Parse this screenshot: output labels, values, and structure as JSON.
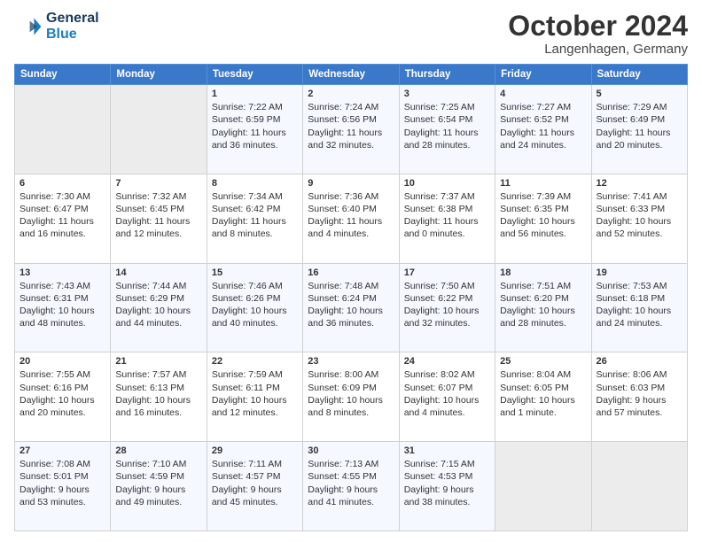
{
  "header": {
    "logo_line1": "General",
    "logo_line2": "Blue",
    "month": "October 2024",
    "location": "Langenhagen, Germany"
  },
  "weekdays": [
    "Sunday",
    "Monday",
    "Tuesday",
    "Wednesday",
    "Thursday",
    "Friday",
    "Saturday"
  ],
  "weeks": [
    [
      {
        "day": "",
        "lines": [],
        "empty": true
      },
      {
        "day": "",
        "lines": [],
        "empty": true
      },
      {
        "day": "1",
        "lines": [
          "Sunrise: 7:22 AM",
          "Sunset: 6:59 PM",
          "Daylight: 11 hours",
          "and 36 minutes."
        ]
      },
      {
        "day": "2",
        "lines": [
          "Sunrise: 7:24 AM",
          "Sunset: 6:56 PM",
          "Daylight: 11 hours",
          "and 32 minutes."
        ]
      },
      {
        "day": "3",
        "lines": [
          "Sunrise: 7:25 AM",
          "Sunset: 6:54 PM",
          "Daylight: 11 hours",
          "and 28 minutes."
        ]
      },
      {
        "day": "4",
        "lines": [
          "Sunrise: 7:27 AM",
          "Sunset: 6:52 PM",
          "Daylight: 11 hours",
          "and 24 minutes."
        ]
      },
      {
        "day": "5",
        "lines": [
          "Sunrise: 7:29 AM",
          "Sunset: 6:49 PM",
          "Daylight: 11 hours",
          "and 20 minutes."
        ]
      }
    ],
    [
      {
        "day": "6",
        "lines": [
          "Sunrise: 7:30 AM",
          "Sunset: 6:47 PM",
          "Daylight: 11 hours",
          "and 16 minutes."
        ]
      },
      {
        "day": "7",
        "lines": [
          "Sunrise: 7:32 AM",
          "Sunset: 6:45 PM",
          "Daylight: 11 hours",
          "and 12 minutes."
        ]
      },
      {
        "day": "8",
        "lines": [
          "Sunrise: 7:34 AM",
          "Sunset: 6:42 PM",
          "Daylight: 11 hours",
          "and 8 minutes."
        ]
      },
      {
        "day": "9",
        "lines": [
          "Sunrise: 7:36 AM",
          "Sunset: 6:40 PM",
          "Daylight: 11 hours",
          "and 4 minutes."
        ]
      },
      {
        "day": "10",
        "lines": [
          "Sunrise: 7:37 AM",
          "Sunset: 6:38 PM",
          "Daylight: 11 hours",
          "and 0 minutes."
        ]
      },
      {
        "day": "11",
        "lines": [
          "Sunrise: 7:39 AM",
          "Sunset: 6:35 PM",
          "Daylight: 10 hours",
          "and 56 minutes."
        ]
      },
      {
        "day": "12",
        "lines": [
          "Sunrise: 7:41 AM",
          "Sunset: 6:33 PM",
          "Daylight: 10 hours",
          "and 52 minutes."
        ]
      }
    ],
    [
      {
        "day": "13",
        "lines": [
          "Sunrise: 7:43 AM",
          "Sunset: 6:31 PM",
          "Daylight: 10 hours",
          "and 48 minutes."
        ]
      },
      {
        "day": "14",
        "lines": [
          "Sunrise: 7:44 AM",
          "Sunset: 6:29 PM",
          "Daylight: 10 hours",
          "and 44 minutes."
        ]
      },
      {
        "day": "15",
        "lines": [
          "Sunrise: 7:46 AM",
          "Sunset: 6:26 PM",
          "Daylight: 10 hours",
          "and 40 minutes."
        ]
      },
      {
        "day": "16",
        "lines": [
          "Sunrise: 7:48 AM",
          "Sunset: 6:24 PM",
          "Daylight: 10 hours",
          "and 36 minutes."
        ]
      },
      {
        "day": "17",
        "lines": [
          "Sunrise: 7:50 AM",
          "Sunset: 6:22 PM",
          "Daylight: 10 hours",
          "and 32 minutes."
        ]
      },
      {
        "day": "18",
        "lines": [
          "Sunrise: 7:51 AM",
          "Sunset: 6:20 PM",
          "Daylight: 10 hours",
          "and 28 minutes."
        ]
      },
      {
        "day": "19",
        "lines": [
          "Sunrise: 7:53 AM",
          "Sunset: 6:18 PM",
          "Daylight: 10 hours",
          "and 24 minutes."
        ]
      }
    ],
    [
      {
        "day": "20",
        "lines": [
          "Sunrise: 7:55 AM",
          "Sunset: 6:16 PM",
          "Daylight: 10 hours",
          "and 20 minutes."
        ]
      },
      {
        "day": "21",
        "lines": [
          "Sunrise: 7:57 AM",
          "Sunset: 6:13 PM",
          "Daylight: 10 hours",
          "and 16 minutes."
        ]
      },
      {
        "day": "22",
        "lines": [
          "Sunrise: 7:59 AM",
          "Sunset: 6:11 PM",
          "Daylight: 10 hours",
          "and 12 minutes."
        ]
      },
      {
        "day": "23",
        "lines": [
          "Sunrise: 8:00 AM",
          "Sunset: 6:09 PM",
          "Daylight: 10 hours",
          "and 8 minutes."
        ]
      },
      {
        "day": "24",
        "lines": [
          "Sunrise: 8:02 AM",
          "Sunset: 6:07 PM",
          "Daylight: 10 hours",
          "and 4 minutes."
        ]
      },
      {
        "day": "25",
        "lines": [
          "Sunrise: 8:04 AM",
          "Sunset: 6:05 PM",
          "Daylight: 10 hours",
          "and 1 minute."
        ]
      },
      {
        "day": "26",
        "lines": [
          "Sunrise: 8:06 AM",
          "Sunset: 6:03 PM",
          "Daylight: 9 hours",
          "and 57 minutes."
        ]
      }
    ],
    [
      {
        "day": "27",
        "lines": [
          "Sunrise: 7:08 AM",
          "Sunset: 5:01 PM",
          "Daylight: 9 hours",
          "and 53 minutes."
        ]
      },
      {
        "day": "28",
        "lines": [
          "Sunrise: 7:10 AM",
          "Sunset: 4:59 PM",
          "Daylight: 9 hours",
          "and 49 minutes."
        ]
      },
      {
        "day": "29",
        "lines": [
          "Sunrise: 7:11 AM",
          "Sunset: 4:57 PM",
          "Daylight: 9 hours",
          "and 45 minutes."
        ]
      },
      {
        "day": "30",
        "lines": [
          "Sunrise: 7:13 AM",
          "Sunset: 4:55 PM",
          "Daylight: 9 hours",
          "and 41 minutes."
        ]
      },
      {
        "day": "31",
        "lines": [
          "Sunrise: 7:15 AM",
          "Sunset: 4:53 PM",
          "Daylight: 9 hours",
          "and 38 minutes."
        ]
      },
      {
        "day": "",
        "lines": [],
        "empty": true
      },
      {
        "day": "",
        "lines": [],
        "empty": true
      }
    ]
  ]
}
